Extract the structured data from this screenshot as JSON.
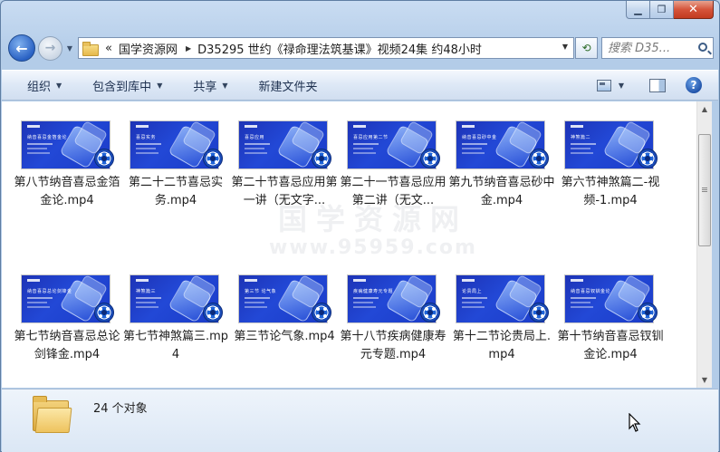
{
  "window": {
    "caption": {
      "minimize": "▁",
      "maximize": "❐",
      "close": "✕"
    }
  },
  "nav": {
    "back_glyph": "←",
    "forward_glyph": "→",
    "address": {
      "overflow": "«",
      "parts": [
        "国学资源网",
        "D35295 世约《禄命理法筑基课》视频24集 约48小时"
      ]
    },
    "refresh_glyph": "⟲",
    "search": {
      "placeholder": "搜索 D35..."
    }
  },
  "toolbar": {
    "organize": "组织",
    "include_in_library": "包含到库中",
    "share": "共享",
    "new_folder": "新建文件夹",
    "help": "?"
  },
  "watermark": {
    "line1": "国学资源网",
    "line2": "www.95959.com"
  },
  "files": [
    {
      "name": "第八节纳音喜忌金箔金论.mp4",
      "thumb_title": "纳音喜忌金箔金论"
    },
    {
      "name": "第二十二节喜忌实务.mp4",
      "thumb_title": "喜忌实务"
    },
    {
      "name": "第二十节喜忌应用第一讲（无文字...",
      "thumb_title": "喜忌应用"
    },
    {
      "name": "第二十一节喜忌应用第二讲（无文...",
      "thumb_title": "喜忌应用第二节"
    },
    {
      "name": "第九节纳音喜忌砂中金.mp4",
      "thumb_title": "纳音喜忌砂中金"
    },
    {
      "name": "第六节神煞篇二-视频-1.mp4",
      "thumb_title": "神煞篇二"
    },
    {
      "name": "第七节纳音喜忌总论剑锋金.mp4",
      "thumb_title": "纳音喜忌总论剑锋金"
    },
    {
      "name": "第七节神煞篇三.mp4",
      "thumb_title": "神煞篇三"
    },
    {
      "name": "第三节论气象.mp4",
      "thumb_title": "第三节 论气象"
    },
    {
      "name": "第十八节疾病健康寿元专题.mp4",
      "thumb_title": "疾病健康寿元专题"
    },
    {
      "name": "第十二节论贵局上.mp4",
      "thumb_title": "论贵局上"
    },
    {
      "name": "第十节纳音喜忌钗钏金论.mp4",
      "thumb_title": "纳音喜忌钗钏金论"
    }
  ],
  "status": {
    "count_text": "24 个对象"
  },
  "scrollbar": {
    "up": "▲",
    "down": "▼"
  }
}
